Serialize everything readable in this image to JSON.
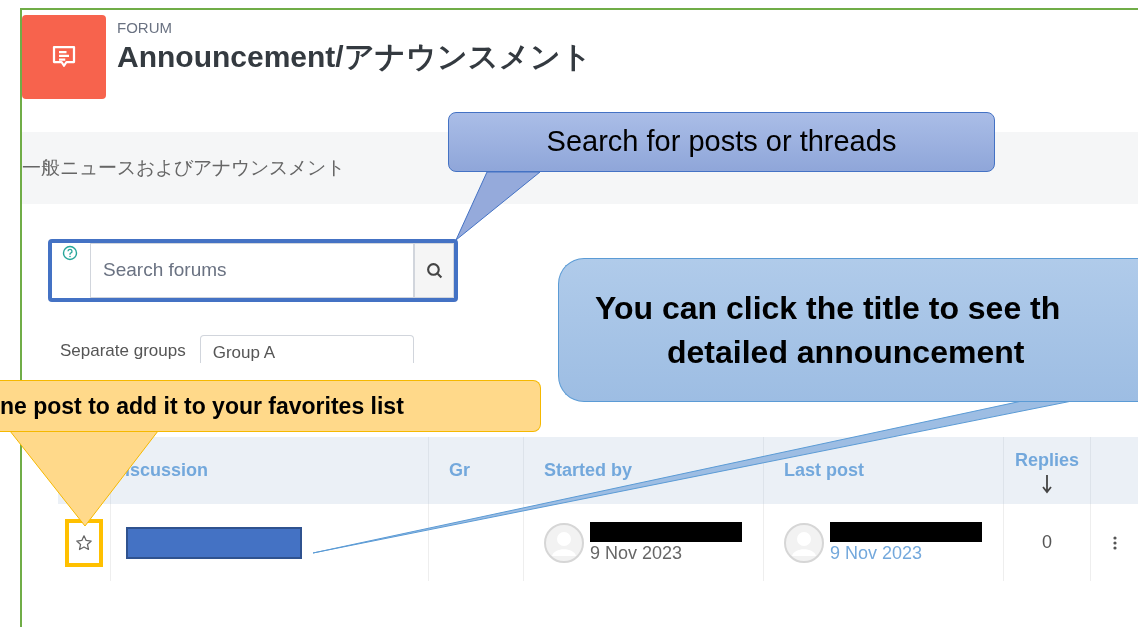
{
  "module": {
    "type_label": "FORUM",
    "title": "Announcement/アナウンスメント"
  },
  "description": "一般ニュースおよびアナウンスメント",
  "search": {
    "placeholder": "Search forums"
  },
  "group_filter": {
    "label": "Separate groups",
    "value": "Group A"
  },
  "table": {
    "columns": [
      {
        "label": "iscussion",
        "sorted": false
      },
      {
        "label": "Gr",
        "sorted": false
      },
      {
        "label": "Started by",
        "sorted": false
      },
      {
        "label": "Last post",
        "sorted": false
      },
      {
        "label": "Replies",
        "sorted": true
      }
    ],
    "rows": [
      {
        "starred": false,
        "started_date": "9 Nov 2023",
        "last_post_date": "9 Nov 2023",
        "replies": "0"
      }
    ]
  },
  "callouts": [
    {
      "kind": "blue",
      "lines": [
        "Search for posts or threads"
      ]
    },
    {
      "kind": "blue-large",
      "lines": [
        "You can click the title to see th",
        "detailed announcement"
      ]
    },
    {
      "kind": "yellow",
      "lines": [
        "ne post to add it to your favorites list"
      ]
    }
  ]
}
